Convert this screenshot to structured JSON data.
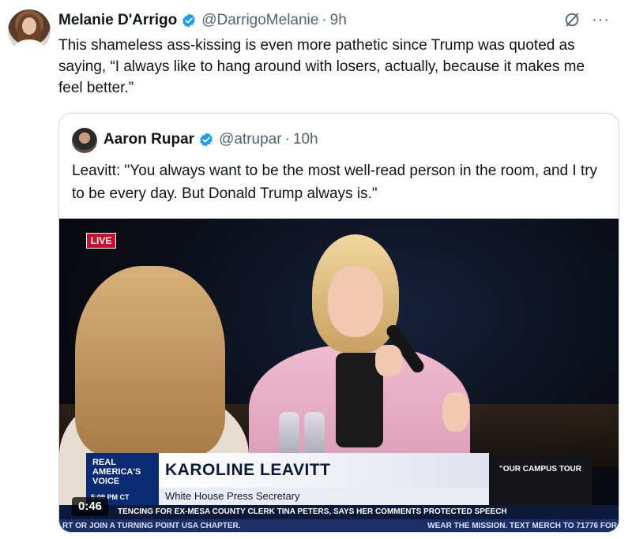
{
  "tweet": {
    "author_name": "Melanie D'Arrigo",
    "handle": "@DarrigoMelanie",
    "separator": "·",
    "time": "9h",
    "text": "This shameless ass-kissing is even more pathetic since Trump was quoted as saying, “I always like to hang around with losers, actually, because it makes me feel better.”",
    "more_label": "···"
  },
  "quoted_tweet": {
    "author_name": "Aaron Rupar",
    "handle": "@atrupar",
    "separator": "·",
    "time": "10h",
    "text": "Leavitt: \"You always want to be the most well-read person in the room, and I try to be every day. But Donald Trump always is.\""
  },
  "video": {
    "live_badge": "LIVE",
    "duration": "0:46",
    "chyron": {
      "logo_line1": "REAL",
      "logo_line2": "AMERICA'S",
      "logo_line3": "VOICE",
      "logo_time": "5:09 PM CT",
      "name": "KAROLINE LEAVITT",
      "title": "White House Press Secretary",
      "promo": "\"OUR CAMPUS TOUR"
    },
    "ticker_top": "TENCING FOR EX-MESA COUNTY CLERK TINA PETERS, SAYS HER COMMENTS PROTECTED SPEECH",
    "ticker_bottom_left": "RT OR JOIN A TURNING POINT USA CHAPTER.",
    "ticker_bottom_right": "WEAR THE MISSION. TEXT MERCH TO 71776 FOR"
  },
  "colors": {
    "verified": "#1d9bf0",
    "text": "#0f1419",
    "secondary": "#536471",
    "border": "#cfd9de"
  }
}
